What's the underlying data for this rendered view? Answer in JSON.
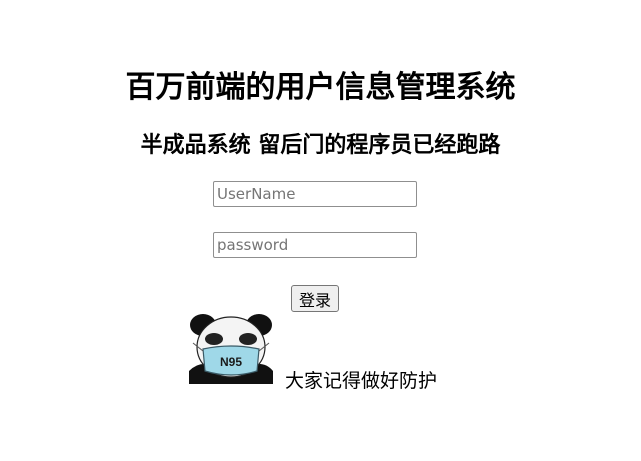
{
  "page": {
    "title": "百万前端的用户信息管理系统",
    "subtitle": "半成品系统 留后门的程序员已经跑路"
  },
  "form": {
    "username_placeholder": "UserName",
    "username_value": "",
    "password_placeholder": "password",
    "password_value": "",
    "login_label": "登录"
  },
  "footer": {
    "meme_mask_text": "N95",
    "caption": "大家记得做好防护"
  },
  "colors": {
    "background": "#ffffff",
    "text": "#000000",
    "input_border": "#8f8f8f",
    "button_bg": "#efefef",
    "mask_color": "#9fd8e8"
  }
}
